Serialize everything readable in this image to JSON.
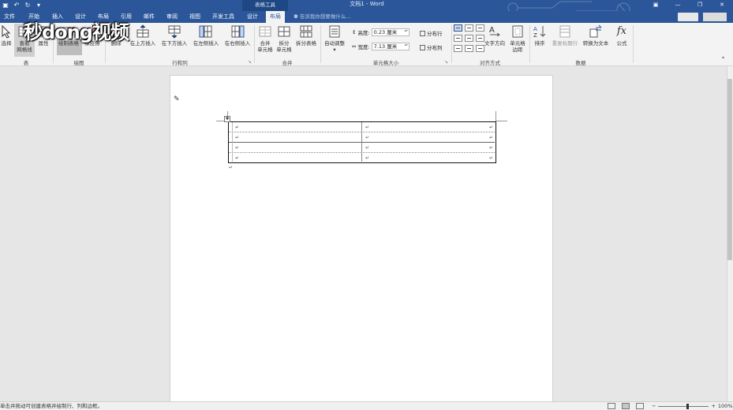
{
  "app": {
    "doc_title": "文档1 - Word",
    "context_tab_title": "表格工具",
    "colors": {
      "accent": "#2b579a",
      "ribbon_bg": "#f3f3f3"
    }
  },
  "qat": [
    {
      "icon": "save-icon",
      "glyph": "▣"
    },
    {
      "icon": "undo-icon",
      "glyph": "↶"
    },
    {
      "icon": "redo-icon",
      "glyph": "↻"
    },
    {
      "icon": "customize-icon",
      "glyph": "▾"
    }
  ],
  "window": [
    {
      "icon": "ribbon-options-icon",
      "glyph": "▣"
    },
    {
      "icon": "minimize-icon",
      "glyph": "—"
    },
    {
      "icon": "restore-icon",
      "glyph": "❐"
    },
    {
      "icon": "close-icon",
      "glyph": "✕"
    }
  ],
  "tabs": [
    "文件",
    "开始",
    "插入",
    "设计",
    "布局",
    "引用",
    "邮件",
    "审阅",
    "视图",
    "开发工具",
    "设计",
    "布局"
  ],
  "tell_me": "告诉我你想要做什么...",
  "watermark": "秒dong视频",
  "ribbon": {
    "table": {
      "select": "选择",
      "gridlines": "查看\n网格线",
      "properties": "属性",
      "group": "表"
    },
    "draw": {
      "draw_table": "绘制表格",
      "eraser": "橡皮擦",
      "group": "绘图"
    },
    "rows_cols": {
      "delete": "删除",
      "insert_above": "在上方插入",
      "insert_below": "在下方插入",
      "insert_left": "在左侧插入",
      "insert_right": "在右侧插入",
      "group": "行和列"
    },
    "merge": {
      "merge_cells": "合并\n单元格",
      "split_cells": "拆分\n单元格",
      "split_table": "拆分表格",
      "group": "合并"
    },
    "cell_size": {
      "autofit": "自动调整",
      "height_label": "高度:",
      "height_value": "0.23 厘米",
      "width_label": "宽度:",
      "width_value": "7.13 厘米",
      "distribute_rows": "分布行",
      "distribute_cols": "分布列",
      "group": "单元格大小"
    },
    "alignment": {
      "text_direction": "文字方向",
      "cell_margins": "单元格\n边距",
      "group": "对齐方式"
    },
    "data": {
      "sort": "排序",
      "repeat_header": "重复标题行",
      "convert_to_text": "转换为文本",
      "formula": "公式",
      "formula_glyph": "fx",
      "group": "数据"
    }
  },
  "document": {
    "cell_mark": "↵",
    "table_rows": 4,
    "table_cols": 2
  },
  "status": {
    "message": "单击并拖动可创建表格并绘制行、列和边框。",
    "zoom": "100%",
    "zoom_minus": "−",
    "zoom_plus": "+"
  }
}
